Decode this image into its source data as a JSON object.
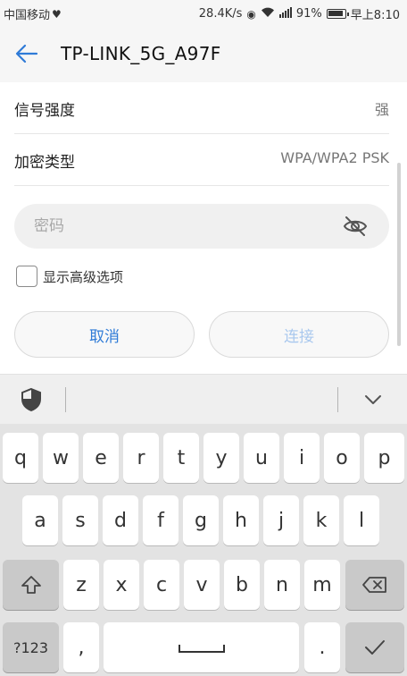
{
  "status_bar": {
    "carrier": "中国移动",
    "speed": "28.4K/s",
    "signal": "4G",
    "battery": "91%",
    "time": "早上8:10"
  },
  "header": {
    "title": "TP-LINK_5G_A97F"
  },
  "details": {
    "signal_label": "信号强度",
    "signal_value": "强",
    "security_label": "加密类型",
    "security_value": "WPA/WPA2 PSK"
  },
  "password": {
    "placeholder": "密码"
  },
  "advanced": {
    "label": "显示高级选项"
  },
  "actions": {
    "cancel": "取消",
    "connect": "连接"
  },
  "keyboard": {
    "row1": [
      "q",
      "w",
      "e",
      "r",
      "t",
      "y",
      "u",
      "i",
      "o",
      "p"
    ],
    "row2": [
      "a",
      "s",
      "d",
      "f",
      "g",
      "h",
      "j",
      "k",
      "l"
    ],
    "row3": [
      "z",
      "x",
      "c",
      "v",
      "b",
      "n",
      "m"
    ],
    "symbols": "?123",
    "comma": ",",
    "period": "."
  },
  "colors": {
    "accent": "#2f7bd7",
    "accent_disabled": "#a9c8ee"
  }
}
